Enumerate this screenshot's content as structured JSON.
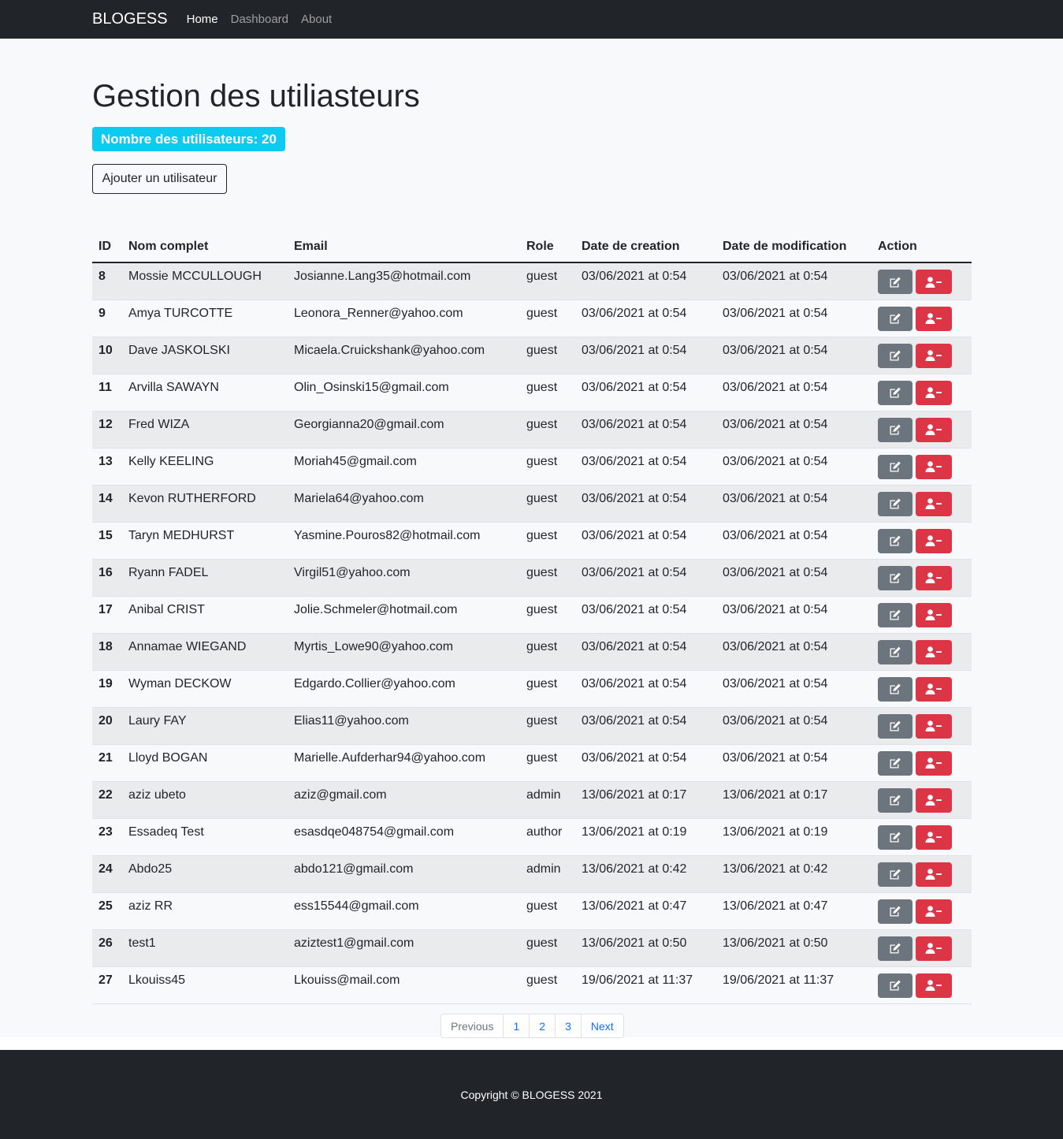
{
  "navbar": {
    "brand": "BLOGESS",
    "links": [
      "Home",
      "Dashboard",
      "About"
    ]
  },
  "page": {
    "title": "Gestion des utiliasteurs",
    "count_badge": "Nombre des utilisateurs: 20",
    "add_button": "Ajouter un utilisateur"
  },
  "table": {
    "headers": [
      "ID",
      "Nom complet",
      "Email",
      "Role",
      "Date de creation",
      "Date de modification",
      "Action"
    ],
    "rows": [
      [
        "8",
        "Mossie MCCULLOUGH",
        "Josianne.Lang35@hotmail.com",
        "guest",
        "03/06/2021 at 0:54",
        "03/06/2021 at 0:54"
      ],
      [
        "9",
        "Amya TURCOTTE",
        "Leonora_Renner@yahoo.com",
        "guest",
        "03/06/2021 at 0:54",
        "03/06/2021 at 0:54"
      ],
      [
        "10",
        "Dave JASKOLSKI",
        "Micaela.Cruickshank@yahoo.com",
        "guest",
        "03/06/2021 at 0:54",
        "03/06/2021 at 0:54"
      ],
      [
        "11",
        "Arvilla SAWAYN",
        "Olin_Osinski15@gmail.com",
        "guest",
        "03/06/2021 at 0:54",
        "03/06/2021 at 0:54"
      ],
      [
        "12",
        "Fred WIZA",
        "Georgianna20@gmail.com",
        "guest",
        "03/06/2021 at 0:54",
        "03/06/2021 at 0:54"
      ],
      [
        "13",
        "Kelly KEELING",
        "Moriah45@gmail.com",
        "guest",
        "03/06/2021 at 0:54",
        "03/06/2021 at 0:54"
      ],
      [
        "14",
        "Kevon RUTHERFORD",
        "Mariela64@yahoo.com",
        "guest",
        "03/06/2021 at 0:54",
        "03/06/2021 at 0:54"
      ],
      [
        "15",
        "Taryn MEDHURST",
        "Yasmine.Pouros82@hotmail.com",
        "guest",
        "03/06/2021 at 0:54",
        "03/06/2021 at 0:54"
      ],
      [
        "16",
        "Ryann FADEL",
        "Virgil51@yahoo.com",
        "guest",
        "03/06/2021 at 0:54",
        "03/06/2021 at 0:54"
      ],
      [
        "17",
        "Anibal CRIST",
        "Jolie.Schmeler@hotmail.com",
        "guest",
        "03/06/2021 at 0:54",
        "03/06/2021 at 0:54"
      ],
      [
        "18",
        "Annamae WIEGAND",
        "Myrtis_Lowe90@yahoo.com",
        "guest",
        "03/06/2021 at 0:54",
        "03/06/2021 at 0:54"
      ],
      [
        "19",
        "Wyman DECKOW",
        "Edgardo.Collier@yahoo.com",
        "guest",
        "03/06/2021 at 0:54",
        "03/06/2021 at 0:54"
      ],
      [
        "20",
        "Laury FAY",
        "Elias11@yahoo.com",
        "guest",
        "03/06/2021 at 0:54",
        "03/06/2021 at 0:54"
      ],
      [
        "21",
        "Lloyd BOGAN",
        "Marielle.Aufderhar94@yahoo.com",
        "guest",
        "03/06/2021 at 0:54",
        "03/06/2021 at 0:54"
      ],
      [
        "22",
        "aziz ubeto",
        "aziz@gmail.com",
        "admin",
        "13/06/2021 at 0:17",
        "13/06/2021 at 0:17"
      ],
      [
        "23",
        "Essadeq Test",
        "esasdqe048754@gmail.com",
        "author",
        "13/06/2021 at 0:19",
        "13/06/2021 at 0:19"
      ],
      [
        "24",
        "Abdo25",
        "abdo121@gmail.com",
        "admin",
        "13/06/2021 at 0:42",
        "13/06/2021 at 0:42"
      ],
      [
        "25",
        "aziz RR",
        "ess15544@gmail.com",
        "guest",
        "13/06/2021 at 0:47",
        "13/06/2021 at 0:47"
      ],
      [
        "26",
        "test1",
        "aziztest1@gmail.com",
        "guest",
        "13/06/2021 at 0:50",
        "13/06/2021 at 0:50"
      ],
      [
        "27",
        "Lkouiss45",
        "Lkouiss@mail.com",
        "guest",
        "19/06/2021 at 11:37",
        "19/06/2021 at 11:37"
      ]
    ]
  },
  "pagination": [
    "Previous",
    "1",
    "2",
    "3",
    "Next"
  ],
  "footer": {
    "copyright": "Copyright © BLOGESS 2021"
  },
  "icons": {
    "edit": "edit-icon",
    "delete": "user-minus-icon"
  },
  "colors": {
    "navbar_bg": "#212529",
    "badge_bg": "#0dcaf0",
    "edit_button": "#6c757d",
    "delete_button": "#dc3545",
    "link": "#0d6efd"
  }
}
